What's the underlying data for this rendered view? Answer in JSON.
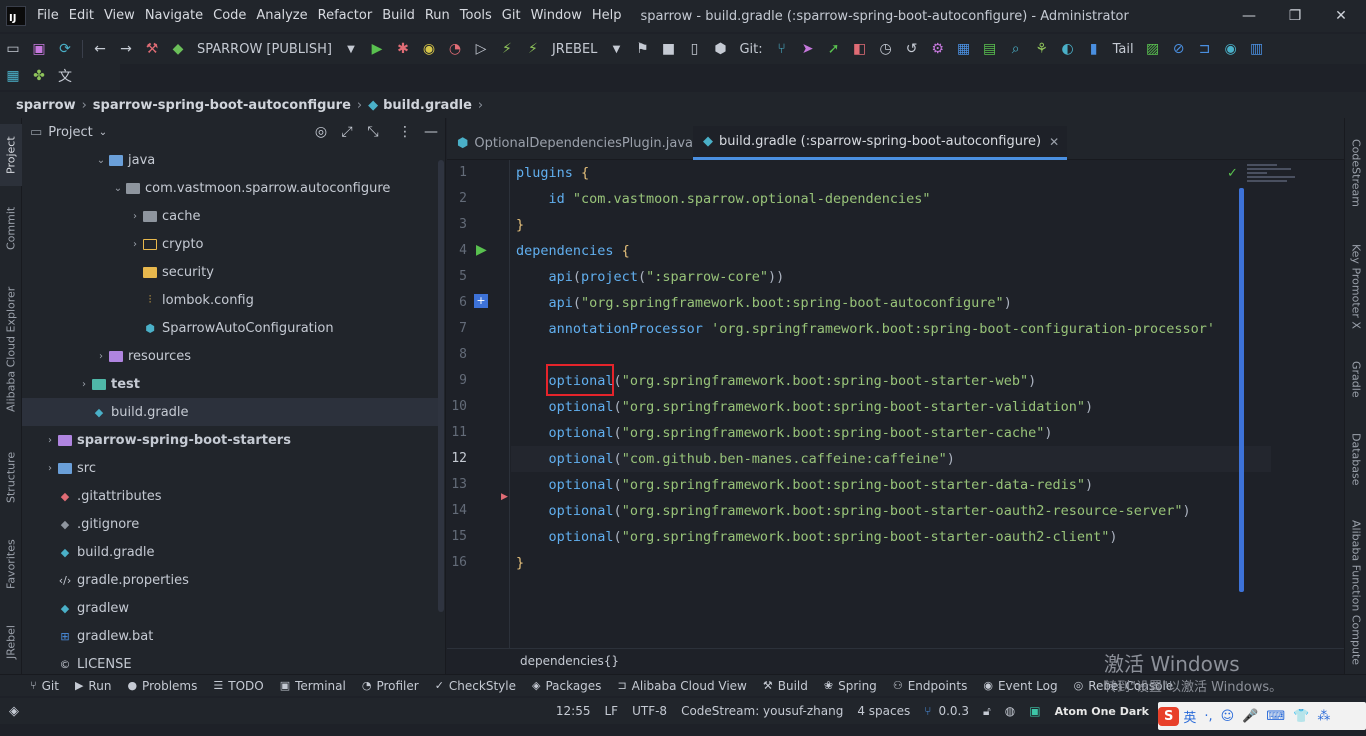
{
  "window": {
    "title": "sparrow - build.gradle (:sparrow-spring-boot-autoconfigure) - Administrator",
    "logo_text": "IJ",
    "minimize": "—",
    "maximize": "❐",
    "close": "✕"
  },
  "menu": [
    "File",
    "Edit",
    "View",
    "Navigate",
    "Code",
    "Analyze",
    "Refactor",
    "Build",
    "Run",
    "Tools",
    "Git",
    "Window",
    "Help"
  ],
  "toolbar": {
    "run_config": "SPARROW [PUBLISH]",
    "jrebel": "JREBEL",
    "git_label": "Git:",
    "tail_label": "Tail"
  },
  "breadcrumb": [
    "sparrow",
    "sparrow-spring-boot-autoconfigure",
    "build.gradle"
  ],
  "left_strip": [
    "Project",
    "Commit",
    "Alibaba Cloud Explorer",
    "Structure",
    "Favorites",
    "JRebel"
  ],
  "right_strip": [
    "CodeStream",
    "Key Promoter X",
    "Gradle",
    "Database",
    "Alibaba Function Compute"
  ],
  "project_panel": {
    "title": "Project",
    "tree": [
      {
        "label": "java",
        "indent": 4,
        "chevron": "⌄",
        "icon": "folder-blue",
        "bold": false
      },
      {
        "label": "com.vastmoon.sparrow.autoconfigure",
        "indent": 5,
        "chevron": "⌄",
        "icon": "folder-gray",
        "bold": false
      },
      {
        "label": "cache",
        "indent": 6,
        "chevron": "›",
        "icon": "folder-gray",
        "bold": false
      },
      {
        "label": "crypto",
        "indent": 6,
        "chevron": "›",
        "icon": "folder-yellow-outline",
        "bold": false
      },
      {
        "label": "security",
        "indent": 6,
        "chevron": "",
        "icon": "folder-yellow",
        "bold": false
      },
      {
        "label": "lombok.config",
        "indent": 6,
        "chevron": "",
        "icon": "config",
        "bold": false
      },
      {
        "label": "SparrowAutoConfiguration",
        "indent": 6,
        "chevron": "",
        "icon": "class",
        "bold": false
      },
      {
        "label": "resources",
        "indent": 4,
        "chevron": "›",
        "icon": "folder-purple",
        "bold": false
      },
      {
        "label": "test",
        "indent": 3,
        "chevron": "›",
        "icon": "folder-teal",
        "bold": true
      },
      {
        "label": "build.gradle",
        "indent": 3,
        "chevron": "",
        "icon": "gradle",
        "bold": false,
        "selected": true
      },
      {
        "label": "sparrow-spring-boot-starters",
        "indent": 1,
        "chevron": "›",
        "icon": "folder-purple",
        "bold": true
      },
      {
        "label": "src",
        "indent": 1,
        "chevron": "›",
        "icon": "folder-blue",
        "bold": false
      },
      {
        "label": ".gitattributes",
        "indent": 1,
        "chevron": "",
        "icon": "git",
        "bold": false
      },
      {
        "label": ".gitignore",
        "indent": 1,
        "chevron": "",
        "icon": "gitignore",
        "bold": false
      },
      {
        "label": "build.gradle",
        "indent": 1,
        "chevron": "",
        "icon": "gradle",
        "bold": false
      },
      {
        "label": "gradle.properties",
        "indent": 1,
        "chevron": "",
        "icon": "props",
        "bold": false
      },
      {
        "label": "gradlew",
        "indent": 1,
        "chevron": "",
        "icon": "gradle",
        "bold": false
      },
      {
        "label": "gradlew.bat",
        "indent": 1,
        "chevron": "",
        "icon": "windows",
        "bold": false
      },
      {
        "label": "LICENSE",
        "indent": 1,
        "chevron": "",
        "icon": "license",
        "bold": false
      }
    ]
  },
  "editor": {
    "tabs": [
      {
        "label": "OptionalDependenciesPlugin.java",
        "active": false
      },
      {
        "label": "build.gradle (:sparrow-spring-boot-autoconfigure)",
        "active": true
      }
    ],
    "current_line": 12,
    "footer": "dependencies{}",
    "lines": [
      [
        {
          "t": "plugins ",
          "c": "kw"
        },
        {
          "t": "{",
          "c": "brace"
        }
      ],
      [
        {
          "t": "    id ",
          "c": "kw"
        },
        {
          "t": "\"com.vastmoon.sparrow.optional-dependencies\"",
          "c": "str"
        }
      ],
      [
        {
          "t": "}",
          "c": "brace"
        }
      ],
      [
        {
          "t": "dependencies ",
          "c": "kw"
        },
        {
          "t": "{",
          "c": "brace"
        }
      ],
      [
        {
          "t": "    api",
          "c": "fn"
        },
        {
          "t": "(",
          "c": "plain"
        },
        {
          "t": "project",
          "c": "fn"
        },
        {
          "t": "(",
          "c": "plain"
        },
        {
          "t": "\":sparrow-core\"",
          "c": "str"
        },
        {
          "t": "))",
          "c": "plain"
        }
      ],
      [
        {
          "t": "    api",
          "c": "fn"
        },
        {
          "t": "(",
          "c": "plain"
        },
        {
          "t": "\"org.springframework.boot:spring-boot-autoconfigure\"",
          "c": "str"
        },
        {
          "t": ")",
          "c": "plain"
        }
      ],
      [
        {
          "t": "    annotationProcessor ",
          "c": "fn"
        },
        {
          "t": "'org.springframework.boot:spring-boot-configuration-processor'",
          "c": "str"
        }
      ],
      [],
      [
        {
          "t": "    optional",
          "c": "fn"
        },
        {
          "t": "(",
          "c": "plain"
        },
        {
          "t": "\"org.springframework.boot:spring-boot-starter-web\"",
          "c": "str"
        },
        {
          "t": ")",
          "c": "plain"
        }
      ],
      [
        {
          "t": "    optional",
          "c": "fn"
        },
        {
          "t": "(",
          "c": "plain"
        },
        {
          "t": "\"org.springframework.boot:spring-boot-starter-validation\"",
          "c": "str"
        },
        {
          "t": ")",
          "c": "plain"
        }
      ],
      [
        {
          "t": "    optional",
          "c": "fn"
        },
        {
          "t": "(",
          "c": "plain"
        },
        {
          "t": "\"org.springframework.boot:spring-boot-starter-cache\"",
          "c": "str"
        },
        {
          "t": ")",
          "c": "plain"
        }
      ],
      [
        {
          "t": "    optional",
          "c": "fn"
        },
        {
          "t": "(",
          "c": "plain"
        },
        {
          "t": "\"com.github.ben-manes.caffeine:caffeine\"",
          "c": "str"
        },
        {
          "t": ")",
          "c": "plain"
        }
      ],
      [
        {
          "t": "    optional",
          "c": "fn"
        },
        {
          "t": "(",
          "c": "plain"
        },
        {
          "t": "\"org.springframework.boot:spring-boot-starter-data-redis\"",
          "c": "str"
        },
        {
          "t": ")",
          "c": "plain"
        }
      ],
      [
        {
          "t": "    optional",
          "c": "fn"
        },
        {
          "t": "(",
          "c": "plain"
        },
        {
          "t": "\"org.springframework.boot:spring-boot-starter-oauth2-resource-server\"",
          "c": "str"
        },
        {
          "t": ")",
          "c": "plain"
        }
      ],
      [
        {
          "t": "    optional",
          "c": "fn"
        },
        {
          "t": "(",
          "c": "plain"
        },
        {
          "t": "\"org.springframework.boot:spring-boot-starter-oauth2-client\"",
          "c": "str"
        },
        {
          "t": ")",
          "c": "plain"
        }
      ],
      [
        {
          "t": "}",
          "c": "brace"
        }
      ]
    ]
  },
  "bottom_tools": [
    {
      "label": "Git",
      "icon": "⑂"
    },
    {
      "label": "Run",
      "icon": "▶"
    },
    {
      "label": "Problems",
      "icon": "●"
    },
    {
      "label": "TODO",
      "icon": "☰"
    },
    {
      "label": "Terminal",
      "icon": "▣"
    },
    {
      "label": "Profiler",
      "icon": "◔"
    },
    {
      "label": "CheckStyle",
      "icon": "✓"
    },
    {
      "label": "Packages",
      "icon": "◈"
    },
    {
      "label": "Alibaba Cloud View",
      "icon": "⊐"
    },
    {
      "label": "Build",
      "icon": "⚒"
    },
    {
      "label": "Spring",
      "icon": "❀"
    },
    {
      "label": "Endpoints",
      "icon": "⚇"
    },
    {
      "label": "Event Log",
      "icon": "◉"
    },
    {
      "label": "Rebel Console",
      "icon": "◎"
    }
  ],
  "statusbar": {
    "position": "12:55",
    "line_sep": "LF",
    "encoding": "UTF-8",
    "codestream": "CodeStream: yousuf-zhang",
    "indent": "4 spaces",
    "version": "0.0.3",
    "theme": "Atom One Dark"
  },
  "watermark": {
    "line1": "激活 Windows",
    "line2": "转到\"设置\"以激活 Windows。"
  },
  "ime": [
    "S",
    "英",
    "·,",
    "☺",
    "🎤",
    "⌨",
    "👕",
    "⁂"
  ],
  "colors": {
    "accent": "#4a8fe0",
    "highlight_box": "#e5242b",
    "string": "#98c379",
    "keyword": "#61afef"
  }
}
